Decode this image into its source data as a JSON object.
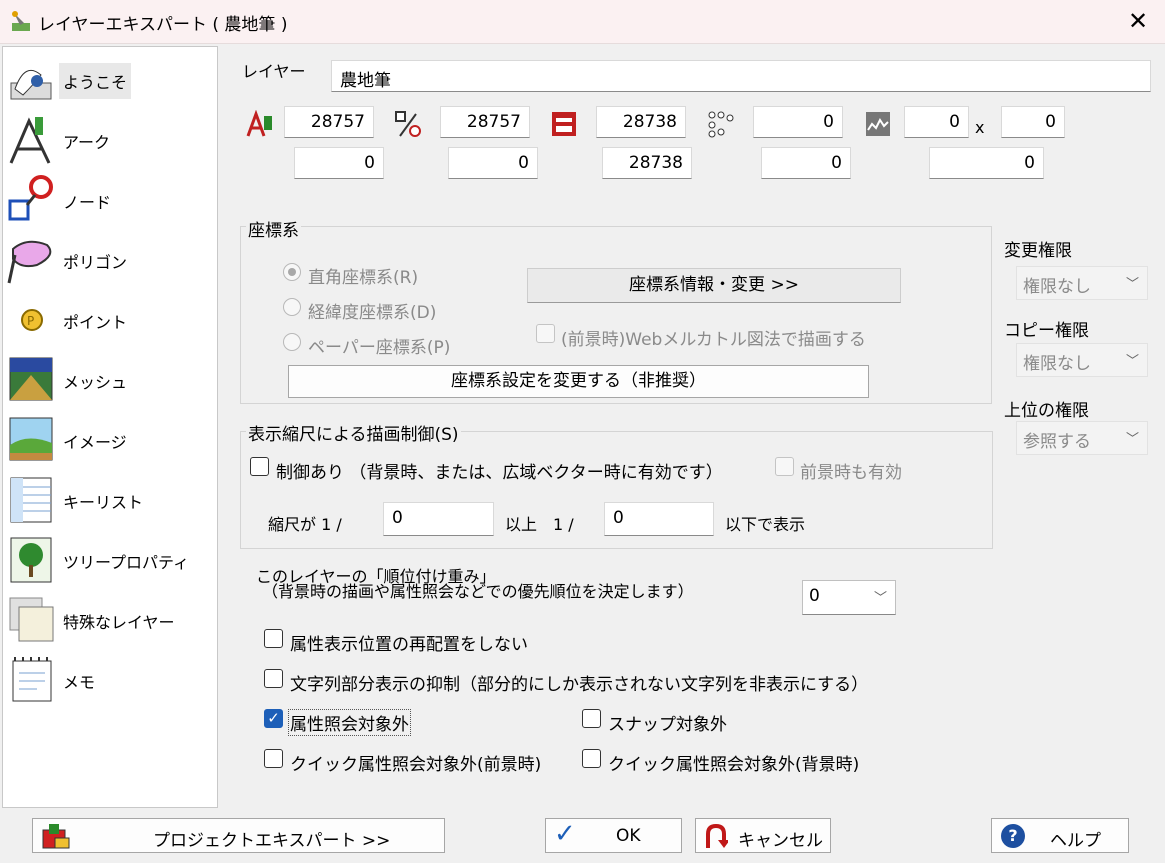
{
  "window": {
    "title": "レイヤーエキスパート ( 農地筆 )",
    "close_label": "✕"
  },
  "sidebar": {
    "items": [
      {
        "label": "ようこそ",
        "icon": "welcome-icon"
      },
      {
        "label": "アーク",
        "icon": "arc-icon"
      },
      {
        "label": "ノード",
        "icon": "node-icon"
      },
      {
        "label": "ポリゴン",
        "icon": "polygon-icon"
      },
      {
        "label": "ポイント",
        "icon": "point-icon"
      },
      {
        "label": "メッシュ",
        "icon": "mesh-icon"
      },
      {
        "label": "イメージ",
        "icon": "image-icon"
      },
      {
        "label": "キーリスト",
        "icon": "keylist-icon"
      },
      {
        "label": "ツリープロパティ",
        "icon": "tree-icon"
      },
      {
        "label": "特殊なレイヤー",
        "icon": "special-layer-icon"
      },
      {
        "label": "メモ",
        "icon": "memo-icon"
      }
    ]
  },
  "layer": {
    "label": "レイヤー",
    "name": "農地筆"
  },
  "counts": {
    "arc_top": "28757",
    "node_top": "28757",
    "polygon_top": "28738",
    "point_top": "0",
    "mesh_top_a": "0",
    "mesh_x": "x",
    "mesh_top_b": "0",
    "arc_bottom": "0",
    "node_bottom": "0",
    "polygon_bottom": "28738",
    "point_bottom": "0",
    "mesh_bottom": "0"
  },
  "coord": {
    "group_label": "座標系",
    "radio_rect": "直角座標系(R)",
    "radio_latlon": "経緯度座標系(D)",
    "radio_paper": "ペーパー座標系(P)",
    "info_button": "座標系情報・変更 >>",
    "web_mercator": "(前景時)Webメルカトル図法で描画する",
    "change_button": "座標系設定を変更する（非推奨）"
  },
  "permissions": {
    "change_label": "変更権限",
    "change_value": "権限なし",
    "copy_label": "コピー権限",
    "copy_value": "権限なし",
    "upper_label": "上位の権限",
    "upper_value": "参照する"
  },
  "scale": {
    "group_label": "表示縮尺による描画制御(S)",
    "control_label": "制御あり （背景時、または、広域ベクター時に有効です）",
    "foreground_label": "前景時も有効",
    "scale_prefix": "縮尺が 1 /",
    "min_value": "0",
    "mid_text": "以上　1 /",
    "max_value": "0",
    "suffix": "以下で表示"
  },
  "priority": {
    "line1": "このレイヤーの「順位付け重み」",
    "line2": "（背景時の描画や属性照会などでの優先順位を決定します）",
    "value": "0"
  },
  "options": {
    "no_relocate": "属性表示位置の再配置をしない",
    "suppress_partial": "文字列部分表示の抑制（部分的にしか表示されない文字列を非表示にする）",
    "exclude_attr": "属性照会対象外",
    "exclude_snap": "スナップ対象外",
    "quick_fg": "クイック属性照会対象外(前景時)",
    "quick_bg": "クイック属性照会対象外(背景時)"
  },
  "footer": {
    "project_button": "プロジェクトエキスパート >>",
    "ok_button": "OK",
    "cancel_button": "キャンセル",
    "help_button": "ヘルプ"
  }
}
